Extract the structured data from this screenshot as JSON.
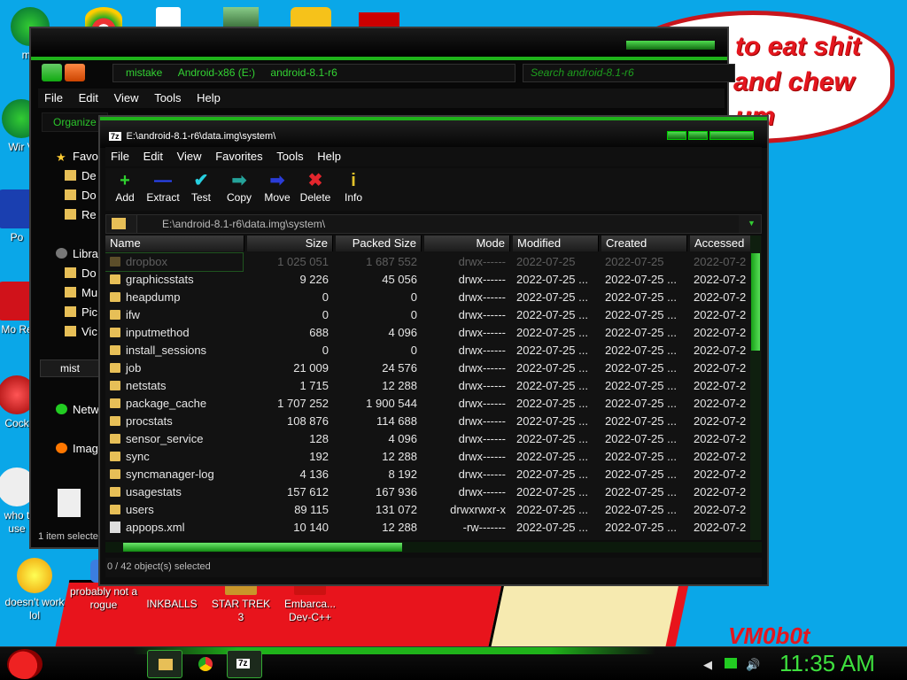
{
  "desktop": {
    "bubble_lines": [
      "to eat shit",
      "and chew",
      "um"
    ],
    "signature": "VM0b0t",
    "icons_left": [
      {
        "label": "mis",
        "icon": "green-orb-icon"
      },
      {
        "label": "Wir V",
        "icon": "green-orb-icon"
      },
      {
        "label": "Po",
        "icon": "powershell-icon"
      },
      {
        "label": "Mo Re",
        "icon": "red-app-icon"
      },
      {
        "label": "Cock",
        "icon": "game-icon"
      },
      {
        "label": "who t use",
        "icon": "app-icon"
      }
    ],
    "icons_bottom": [
      {
        "label": "doesn't work lol",
        "icon": "yahoo-icon"
      },
      {
        "label": "probably not a rogue",
        "icon": "app-icon"
      },
      {
        "label": "INKBALLS",
        "icon": "inkballs-icon"
      },
      {
        "label": "STAR TREK 3",
        "icon": "star-trek-icon"
      },
      {
        "label": "Embarca... Dev-C++",
        "icon": "devcpp-icon"
      }
    ]
  },
  "explorer": {
    "breadcrumb": [
      "mistake",
      "Android-x86 (E:)",
      "android-8.1-r6"
    ],
    "search_placeholder": "Search android-8.1-r6",
    "menu": [
      "File",
      "Edit",
      "View",
      "Tools",
      "Help"
    ],
    "organize": "Organize",
    "sidebar": [
      {
        "label": "Favo",
        "icon": "star-icon"
      },
      {
        "label": "De",
        "icon": "folder-icon"
      },
      {
        "label": "Do",
        "icon": "folder-icon"
      },
      {
        "label": "Re",
        "icon": "folder-icon"
      },
      {
        "label": "Libra",
        "icon": "library-icon"
      },
      {
        "label": "Do",
        "icon": "folder-icon"
      },
      {
        "label": "Mu",
        "icon": "folder-icon"
      },
      {
        "label": "Pic",
        "icon": "folder-icon"
      },
      {
        "label": "Vic",
        "icon": "folder-icon"
      },
      {
        "label": "mist",
        "icon": "green-orb-icon"
      },
      {
        "label": "Netw",
        "icon": "network-icon"
      },
      {
        "label": "Imag",
        "icon": "image-icon"
      }
    ],
    "status": "1 item selecte"
  },
  "zip": {
    "title": "E:\\android-8.1-r6\\data.img\\system\\",
    "logo": "7z",
    "menu": [
      "File",
      "Edit",
      "View",
      "Favorites",
      "Tools",
      "Help"
    ],
    "toolbar": [
      {
        "label": "Add",
        "glyph": "+",
        "color": "#2fd12f"
      },
      {
        "label": "Extract",
        "glyph": "—",
        "color": "#2a46ff"
      },
      {
        "label": "Test",
        "glyph": "✔",
        "color": "#27d0e0"
      },
      {
        "label": "Copy",
        "glyph": "➡",
        "color": "#25a39a"
      },
      {
        "label": "Move",
        "glyph": "➡",
        "color": "#2a3cd8"
      },
      {
        "label": "Delete",
        "glyph": "✖",
        "color": "#e3262d"
      },
      {
        "label": "Info",
        "glyph": "i",
        "color": "#e2c22a"
      }
    ],
    "path": "E:\\android-8.1-r6\\data.img\\system\\",
    "columns": [
      "Name",
      "Size",
      "Packed Size",
      "Mode",
      "Modified",
      "Created",
      "Accessed"
    ],
    "rows": [
      {
        "name": "dropbox",
        "size": "1 025 051",
        "packed": "1 687 552",
        "mode": "drwx------",
        "modified": "2022-07-25",
        "created": "2022-07-25",
        "accessed": "2022-07-2",
        "type": "folder",
        "selected": true
      },
      {
        "name": "graphicsstats",
        "size": "9 226",
        "packed": "45 056",
        "mode": "drwx------",
        "modified": "2022-07-25 ...",
        "created": "2022-07-25 ...",
        "accessed": "2022-07-2",
        "type": "folder"
      },
      {
        "name": "heapdump",
        "size": "0",
        "packed": "0",
        "mode": "drwx------",
        "modified": "2022-07-25 ...",
        "created": "2022-07-25 ...",
        "accessed": "2022-07-2",
        "type": "folder"
      },
      {
        "name": "ifw",
        "size": "0",
        "packed": "0",
        "mode": "drwx------",
        "modified": "2022-07-25 ...",
        "created": "2022-07-25 ...",
        "accessed": "2022-07-2",
        "type": "folder"
      },
      {
        "name": "inputmethod",
        "size": "688",
        "packed": "4 096",
        "mode": "drwx------",
        "modified": "2022-07-25 ...",
        "created": "2022-07-25 ...",
        "accessed": "2022-07-2",
        "type": "folder"
      },
      {
        "name": "install_sessions",
        "size": "0",
        "packed": "0",
        "mode": "drwx------",
        "modified": "2022-07-25 ...",
        "created": "2022-07-25 ...",
        "accessed": "2022-07-2",
        "type": "folder"
      },
      {
        "name": "job",
        "size": "21 009",
        "packed": "24 576",
        "mode": "drwx------",
        "modified": "2022-07-25 ...",
        "created": "2022-07-25 ...",
        "accessed": "2022-07-2",
        "type": "folder"
      },
      {
        "name": "netstats",
        "size": "1 715",
        "packed": "12 288",
        "mode": "drwx------",
        "modified": "2022-07-25 ...",
        "created": "2022-07-25 ...",
        "accessed": "2022-07-2",
        "type": "folder"
      },
      {
        "name": "package_cache",
        "size": "1 707 252",
        "packed": "1 900 544",
        "mode": "drwx------",
        "modified": "2022-07-25 ...",
        "created": "2022-07-25 ...",
        "accessed": "2022-07-2",
        "type": "folder"
      },
      {
        "name": "procstats",
        "size": "108 876",
        "packed": "114 688",
        "mode": "drwx------",
        "modified": "2022-07-25 ...",
        "created": "2022-07-25 ...",
        "accessed": "2022-07-2",
        "type": "folder"
      },
      {
        "name": "sensor_service",
        "size": "128",
        "packed": "4 096",
        "mode": "drwx------",
        "modified": "2022-07-25 ...",
        "created": "2022-07-25 ...",
        "accessed": "2022-07-2",
        "type": "folder"
      },
      {
        "name": "sync",
        "size": "192",
        "packed": "12 288",
        "mode": "drwx------",
        "modified": "2022-07-25 ...",
        "created": "2022-07-25 ...",
        "accessed": "2022-07-2",
        "type": "folder"
      },
      {
        "name": "syncmanager-log",
        "size": "4 136",
        "packed": "8 192",
        "mode": "drwx------",
        "modified": "2022-07-25 ...",
        "created": "2022-07-25 ...",
        "accessed": "2022-07-2",
        "type": "folder"
      },
      {
        "name": "usagestats",
        "size": "157 612",
        "packed": "167 936",
        "mode": "drwx------",
        "modified": "2022-07-25 ...",
        "created": "2022-07-25 ...",
        "accessed": "2022-07-2",
        "type": "folder"
      },
      {
        "name": "users",
        "size": "89 115",
        "packed": "131 072",
        "mode": "drwxrwxr-x",
        "modified": "2022-07-25 ...",
        "created": "2022-07-25 ...",
        "accessed": "2022-07-2",
        "type": "folder"
      },
      {
        "name": "appops.xml",
        "size": "10 140",
        "packed": "12 288",
        "mode": "-rw-------",
        "modified": "2022-07-25 ...",
        "created": "2022-07-25 ...",
        "accessed": "2022-07-2",
        "type": "file"
      }
    ],
    "status": "0 / 42 object(s) selected"
  },
  "taskbar": {
    "clock": "11:35 AM",
    "items": [
      "explorer-icon",
      "chrome-icon",
      "7zip-icon"
    ]
  },
  "colors": {
    "accent": "#1fb21a",
    "clock": "#3ee03e",
    "desktop": "#0aa7e8"
  }
}
